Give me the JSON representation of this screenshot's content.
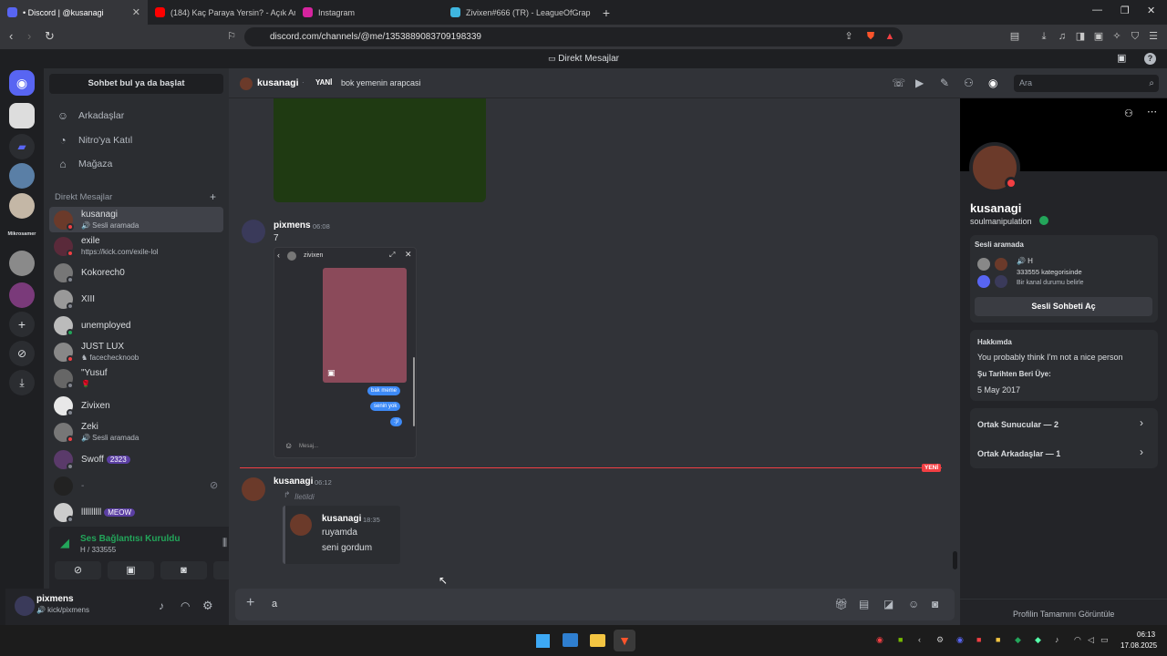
{
  "browser": {
    "tabs": [
      {
        "title": "• Discord | @kusanagi",
        "color": "#5865f2"
      },
      {
        "title": "(184) Kaç Paraya Yersin? - Açık Artırm",
        "color": "#ff0000"
      },
      {
        "title": "Instagram",
        "color": "#d6249f"
      },
      {
        "title": "Zivixen#666 (TR) - LeagueOfGraphs",
        "color": "#3fb6e0"
      }
    ],
    "url": "discord.com/channels/@me/1353889083709198339"
  },
  "discord": {
    "top_title": "Direkt Mesajlar",
    "sidebar": {
      "find_button": "Sohbet bul ya da başlat",
      "nav": [
        {
          "label": "Arkadaşlar",
          "icon": "friends-icon"
        },
        {
          "label": "Nitro'ya Katıl",
          "icon": "nitro-icon"
        },
        {
          "label": "Mağaza",
          "icon": "shop-icon"
        }
      ],
      "dm_header": "Direkt Mesajlar",
      "rail_label": "Mikrosamer",
      "dms": [
        {
          "name": "kusanagi",
          "sub": "🔊 Sesli aramada",
          "status": "#f23f43"
        },
        {
          "name": "exile",
          "sub": "https://kick.com/exile-lol",
          "status": "#f23f43"
        },
        {
          "name": "Kokorech0",
          "sub": "",
          "status": "#80848e"
        },
        {
          "name": "XIII",
          "sub": "",
          "status": "#80848e"
        },
        {
          "name": "unemployed",
          "sub": "",
          "status": "#23a55a"
        },
        {
          "name": "JUST LUX",
          "sub": "♞ facechecknoob",
          "status": "#f23f43"
        },
        {
          "name": "\"Yusuf",
          "sub": "🌹",
          "status": "#80848e"
        },
        {
          "name": "Zivixen",
          "sub": "",
          "status": "#80848e"
        },
        {
          "name": "Zeki",
          "sub": "🔊 Sesli aramada",
          "status": "#f23f43"
        },
        {
          "name": "Swoff",
          "badge": "2323",
          "sub": "",
          "status": "#80848e"
        },
        {
          "name": "-",
          "sub": "",
          "status": "#80848e"
        },
        {
          "name": "llllllllll",
          "badge": "MEOW",
          "sub": "",
          "status": "#80848e"
        }
      ]
    },
    "voice": {
      "status": "Ses Bağlantısı Kuruldu",
      "channel": "H / 333555"
    },
    "user": {
      "name": "pixmens",
      "sub": "🔊 kick/pixmens"
    },
    "chat": {
      "header_name": "kusanagi",
      "header_new": "YANİ",
      "header_note": "bok yemenin arapcasi",
      "search_placeholder": "Ara",
      "messages": [
        {
          "author": "pixmens",
          "time": "06:08",
          "text": "7"
        },
        {
          "author": "kusanagi",
          "time": "06:12",
          "forwarded": "İletildi"
        }
      ],
      "embed": {
        "title": "zivixen",
        "bubbles": [
          "bak meme",
          "senin yok",
          ":)/"
        ],
        "input": "Mesaj..."
      },
      "forward": {
        "author": "kusanagi",
        "time": "18:35",
        "lines": [
          "ruyamda",
          "seni gordum"
        ]
      },
      "new_badge": "YENİ",
      "composer_value": "a"
    },
    "profile": {
      "name": "kusanagi",
      "tag": "soulmanipulation",
      "voice_label": "Sesli aramada",
      "voice_channel": "🔊 H",
      "voice_server": "333555 kategorisinde",
      "voice_hint": "Bir kanal durumu belirle",
      "voice_button": "Sesli Sohbeti Aç",
      "about_label": "Hakkımda",
      "about_text": "You probably think I'm not a nice person",
      "member_label": "Şu Tarihten Beri Üye:",
      "member_date": "5 May 2017",
      "mutual_servers": "Ortak Sunucular — 2",
      "mutual_friends": "Ortak Arkadaşlar — 1",
      "full_profile": "Profilin Tamamını Görüntüle"
    }
  },
  "taskbar": {
    "time": "06:13",
    "date": "17.08.2025"
  }
}
